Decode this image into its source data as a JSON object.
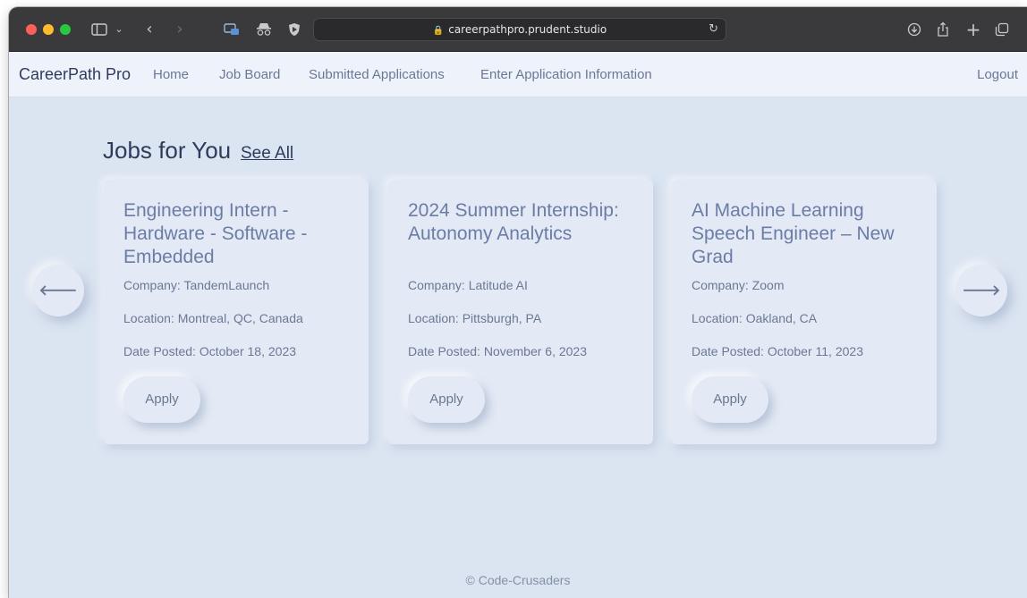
{
  "browser": {
    "url": "careerpathpro.prudent.studio",
    "icons": {
      "sidebar": "sidebar-icon",
      "back": "chevron-left-icon",
      "forward": "chevron-right-icon",
      "lock": "lock-icon",
      "reload": "reload-icon",
      "download": "download-icon",
      "share": "share-icon",
      "new_tab": "plus-icon",
      "tabs": "tabs-overview-icon"
    }
  },
  "nav": {
    "brand": "CareerPath Pro",
    "links": {
      "home": "Home",
      "job_board": "Job Board",
      "submitted": "Submitted Applications",
      "enter": "Enter Application Information"
    },
    "logout": "Logout"
  },
  "main": {
    "title": "Jobs for You",
    "see_all": "See All",
    "cards": [
      {
        "title": "Engineering Intern - Hardware - Software - Embedded",
        "company": "Company: TandemLaunch",
        "location": "Location: Montreal, QC, Canada",
        "date": "Date Posted: October 18, 2023",
        "apply": "Apply"
      },
      {
        "title": "2024 Summer Internship: Autonomy Analytics",
        "company": "Company: Latitude AI",
        "location": "Location: Pittsburgh, PA",
        "date": "Date Posted: November 6, 2023",
        "apply": "Apply"
      },
      {
        "title": "AI Machine Learning Speech Engineer – New Grad",
        "company": "Company: Zoom",
        "location": "Location: Oakland, CA",
        "date": "Date Posted: October 11, 2023",
        "apply": "Apply"
      }
    ]
  },
  "footer": "© Code-Crusaders",
  "colors": {
    "page_bg": "#dbe4f1",
    "nav_bg": "#eef3fb",
    "card_bg": "#e3eaf5",
    "title_text": "#2f3b5c",
    "card_title": "#6b7ca6",
    "muted_text": "#6b7894"
  }
}
